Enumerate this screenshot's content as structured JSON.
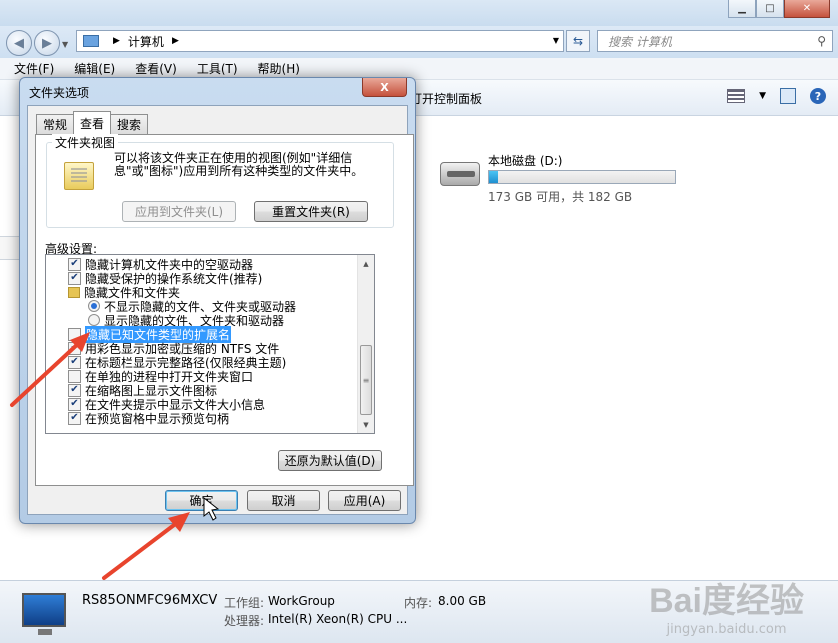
{
  "explorer": {
    "address_location": "计算机",
    "search_placeholder": "搜索 计算机",
    "menu": [
      "文件(F)",
      "编辑(E)",
      "查看(V)",
      "工具(T)",
      "帮助(H)"
    ],
    "toolbar_control_panel": "打开控制面板",
    "drive": {
      "name": "本地磁盘 (D:)",
      "space_text": "173 GB 可用，共 182 GB",
      "used_fraction": 0.05
    },
    "details": {
      "computer_name": "RS85ONMFC96MXCV",
      "workgroup_label": "工作组:",
      "workgroup_value": "WorkGroup",
      "memory_label": "内存:",
      "memory_value": "8.00 GB",
      "cpu_label": "处理器:",
      "cpu_value": "Intel(R) Xeon(R) CPU ..."
    },
    "watermark": {
      "logo": "Bai度经验",
      "url": "jingyan.baidu.com"
    }
  },
  "dialog": {
    "title": "文件夹选项",
    "close_label": "X",
    "tabs": [
      "常规",
      "查看",
      "搜索"
    ],
    "active_tab": "查看",
    "folder_view": {
      "legend": "文件夹视图",
      "description": "可以将该文件夹正在使用的视图(例如\"详细信息\"或\"图标\")应用到所有这种类型的文件夹中。",
      "apply_button": "应用到文件夹(L)",
      "reset_button": "重置文件夹(R)"
    },
    "advanced_label": "高级设置:",
    "advanced_items": [
      {
        "type": "checkbox",
        "checked": true,
        "label": "隐藏计算机文件夹中的空驱动器"
      },
      {
        "type": "checkbox",
        "checked": true,
        "label": "隐藏受保护的操作系统文件(推荐)"
      },
      {
        "type": "folder",
        "label": "隐藏文件和文件夹"
      },
      {
        "type": "radio",
        "checked": true,
        "label": "不显示隐藏的文件、文件夹或驱动器"
      },
      {
        "type": "radio",
        "checked": false,
        "label": "显示隐藏的文件、文件夹和驱动器"
      },
      {
        "type": "checkbox",
        "checked": false,
        "selected": true,
        "label": "隐藏已知文件类型的扩展名"
      },
      {
        "type": "checkbox",
        "checked": true,
        "label": "用彩色显示加密或压缩的 NTFS 文件"
      },
      {
        "type": "checkbox",
        "checked": true,
        "label": "在标题栏显示完整路径(仅限经典主题)"
      },
      {
        "type": "checkbox",
        "checked": false,
        "label": "在单独的进程中打开文件夹窗口"
      },
      {
        "type": "checkbox",
        "checked": true,
        "label": "在缩略图上显示文件图标"
      },
      {
        "type": "checkbox",
        "checked": true,
        "label": "在文件夹提示中显示文件大小信息"
      },
      {
        "type": "checkbox",
        "checked": true,
        "label": "在预览窗格中显示预览句柄"
      }
    ],
    "restore_defaults_button": "还原为默认值(D)",
    "ok_button": "确定",
    "cancel_button": "取消",
    "apply_button": "应用(A)"
  },
  "colors": {
    "annotation_arrow": "#e8442d",
    "selection": "#3399ff"
  }
}
